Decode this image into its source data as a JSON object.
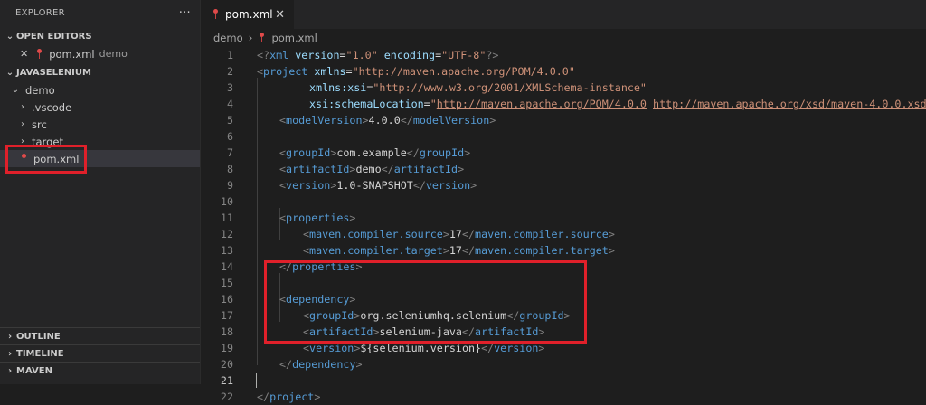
{
  "explorer": {
    "title": "EXPLORER",
    "more_label": "···",
    "open_editors_label": "OPEN EDITORS",
    "open_editor": {
      "close": "✕",
      "file": "pom.xml",
      "folder": "demo"
    },
    "workspace_label": "JAVASELENIUM",
    "tree": {
      "root": "demo",
      "vscode": ".vscode",
      "src": "src",
      "target": "target",
      "pom": "pom.xml"
    },
    "outline_label": "OUTLINE",
    "timeline_label": "TIMELINE",
    "maven_label": "MAVEN"
  },
  "tab": {
    "label": "pom.xml",
    "close": "✕"
  },
  "breadcrumb": {
    "folder": "demo",
    "separator": "›",
    "file": "pom.xml"
  },
  "editor": {
    "line_numbers": [
      "1",
      "2",
      "3",
      "4",
      "5",
      "6",
      "7",
      "8",
      "9",
      "10",
      "11",
      "12",
      "13",
      "14",
      "15",
      "16",
      "17",
      "18",
      "19",
      "20",
      "21",
      "22"
    ],
    "current_line": "21",
    "l1": {
      "open": "<?",
      "tag": "xml",
      "a1": " version",
      "eq1": "=",
      "v1": "\"1.0\"",
      "a2": " encoding",
      "eq2": "=",
      "v2": "\"UTF-8\"",
      "close": "?>"
    },
    "l2": {
      "open": "<",
      "tag": "project",
      "attr": " xmlns",
      "eq": "=",
      "val": "\"http://maven.apache.org/POM/4.0.0\""
    },
    "l3": {
      "attr": "xmlns:xsi",
      "eq": "=",
      "val": "\"http://www.w3.org/2001/XMLSchema-instance\""
    },
    "l4": {
      "attr": "xsi:schemaLocation",
      "eq": "=",
      "q1": "\"",
      "u1": "http://maven.apache.org/POM/4.0.0",
      "sp": " ",
      "u2": "http://maven.apache.org/xsd/maven-4.0.0.xsd",
      "q2": "\"",
      "close": ">"
    },
    "model": {
      "open": "<",
      "tag": "modelVersion",
      "gt": ">",
      "text": "4.0.0",
      "close_open": "</",
      "close_gt": ">"
    },
    "group": {
      "tag": "groupId",
      "text": "com.example"
    },
    "artifact": {
      "tag": "artifactId",
      "text": "demo"
    },
    "version": {
      "tag": "version",
      "text": "1.0-SNAPSHOT"
    },
    "props_tag": "properties",
    "src_prop": {
      "tag": "maven.compiler.source",
      "text": "17"
    },
    "tgt_prop": {
      "tag": "maven.compiler.target",
      "text": "17"
    },
    "dep_tag": "dependency",
    "dep_group": {
      "tag": "groupId",
      "text": "org.seleniumhq.selenium"
    },
    "dep_artifact": {
      "tag": "artifactId",
      "text": "selenium-java"
    },
    "dep_version": {
      "tag": "version",
      "text": "${selenium.version}"
    },
    "project_tag": "project",
    "lt": "<",
    "lts": "</",
    "gt": ">"
  },
  "colors": {
    "annotation": "#e0202a",
    "tag": "#569cd6",
    "attribute": "#9cdcfe",
    "string": "#ce9178"
  }
}
